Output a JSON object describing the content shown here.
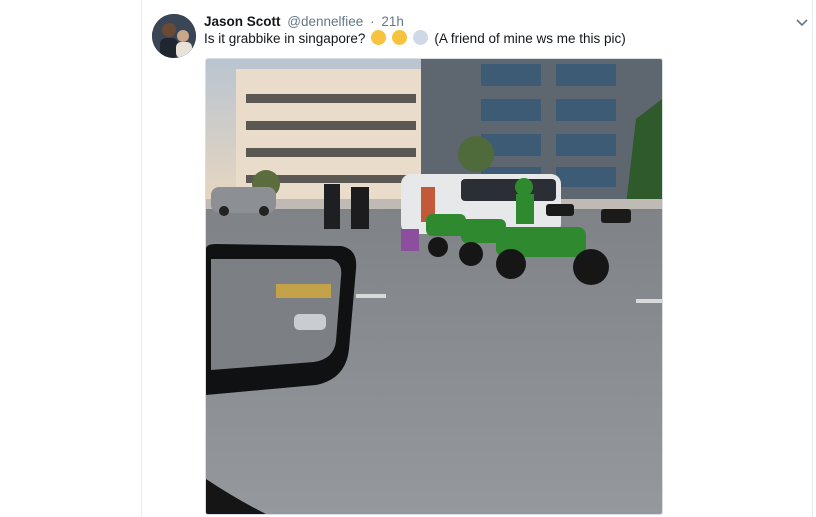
{
  "tweet": {
    "display_name": "Jason Scott",
    "handle": "@dennelfiee",
    "separator": "·",
    "timestamp": "21h",
    "text_before_emoji": "Is it grabbike in singapore?",
    "text_after_emoji": "(A friend of mine ws me this pic)",
    "emojis": [
      "thinking-face-icon",
      "flushed-face-icon",
      "screaming-face-icon"
    ]
  },
  "colors": {
    "name": "#14171a",
    "secondary": "#657786",
    "border": "#e6ecf0",
    "grab_green": "#2f8a2f"
  }
}
